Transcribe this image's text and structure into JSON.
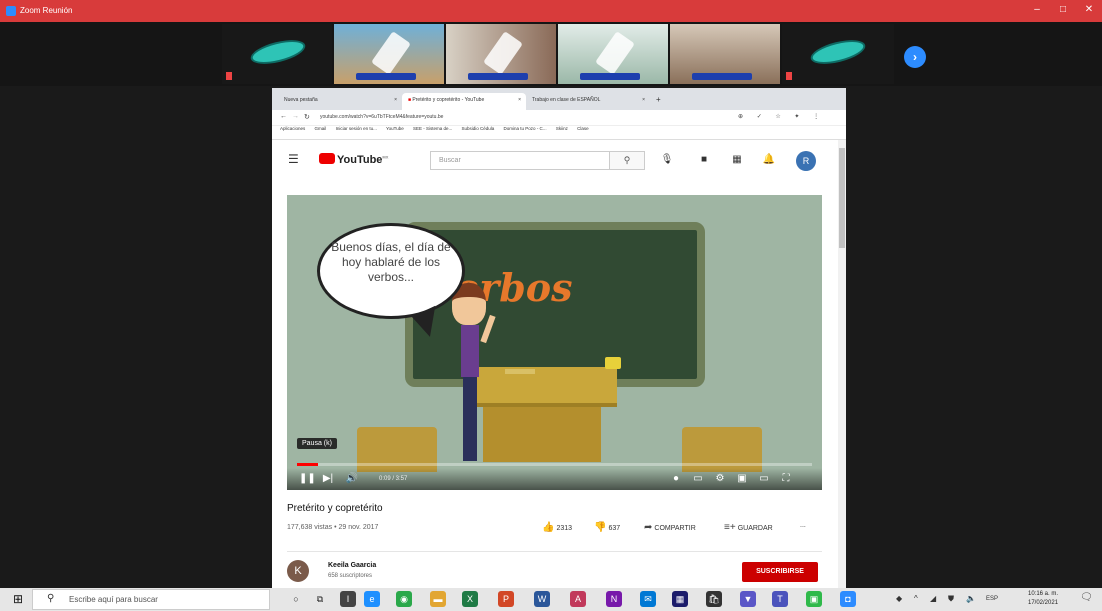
{
  "zoom": {
    "window_title": "Zoom Reunión",
    "minimize_glyph": "–",
    "maximize_glyph": "□",
    "close_glyph": "✕",
    "next_glyph": "›"
  },
  "browser": {
    "tabs": [
      {
        "label": "Nueva pestaña"
      },
      {
        "label": "Pretérito y copretérito - YouTube"
      },
      {
        "label": "Trabajo en clase de ESPAÑOL"
      }
    ],
    "tab_close_glyph": "×",
    "new_tab_glyph": "+",
    "url": "youtube.com/watch?v=6uTbTFtceM4&feature=youtu.be",
    "bookmarks": [
      "Aplicaciones",
      "Gmail",
      "Iniciar sesión en tu...",
      "YouTube",
      "SEE - Sistema de...",
      "Subsidio Cédula",
      "Domina tu Pozo - C...",
      "Skiinz",
      "Clase"
    ]
  },
  "youtube": {
    "logo_text": "YouTube",
    "logo_sup": "MX",
    "search_placeholder": "Buscar",
    "avatar_letter": "R",
    "video": {
      "bubble_text": "Buenos días, el día de hoy hablaré de los verbos...",
      "board_text": "Verbos",
      "pause_tooltip": "Pausa (k)",
      "time": "0:09 / 3:57",
      "progress": 0.04
    },
    "title": "Pretérito y copretérito",
    "meta": "177,638 vistas • 29 nov. 2017",
    "likes": "2313",
    "dislikes": "637",
    "share_label": "COMPARTIR",
    "save_label": "GUARDAR",
    "more_label": "...",
    "channel": {
      "initial": "K",
      "name": "Keeila Gaarcia",
      "subscribers": "658 suscriptores"
    },
    "subscribe_label": "SUSCRIBIRSE"
  },
  "taskbar": {
    "search_placeholder": "Escribe aquí para buscar",
    "language": "ESP",
    "time": "10:16 a. m.",
    "date": "17/02/2021"
  },
  "colors": {
    "zoom_bar": "#d83b3b",
    "zoom_accent": "#2d8cff",
    "youtube_red": "#cc0000"
  }
}
